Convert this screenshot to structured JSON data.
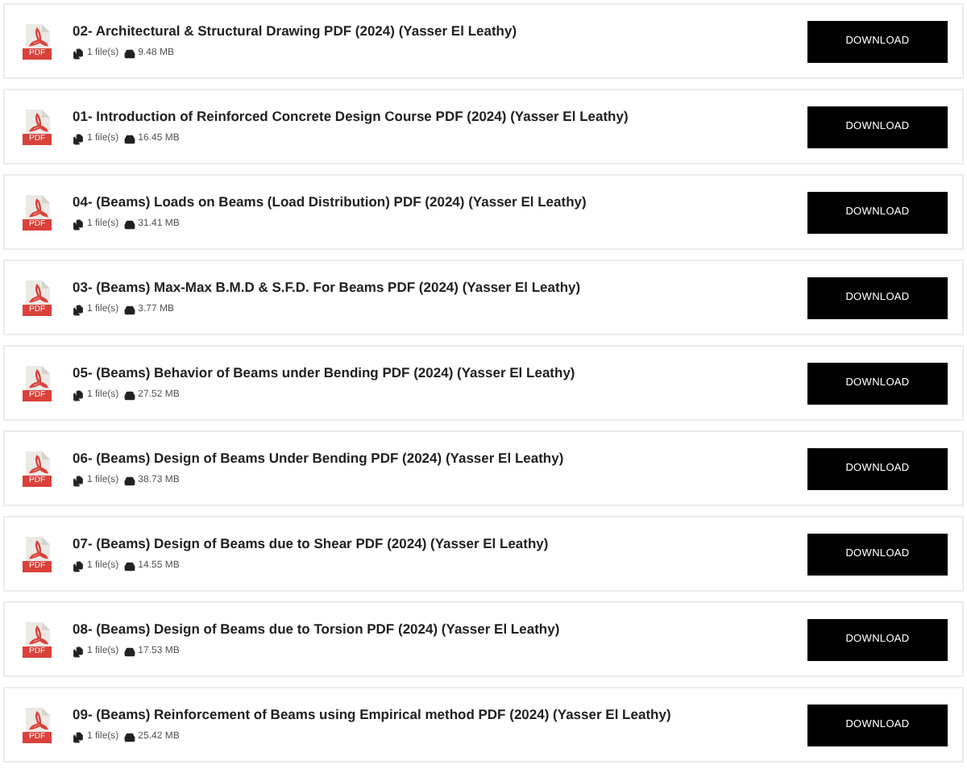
{
  "files": [
    {
      "icon_label": "PDF",
      "title": "02- Architectural & Structural Drawing PDF (2024) (Yasser El Leathy)",
      "file_count": "1 file(s)",
      "size": "9.48 MB",
      "button": "DOWNLOAD"
    },
    {
      "icon_label": "PDF",
      "title": "01- Introduction of Reinforced Concrete Design Course PDF (2024) (Yasser El Leathy)",
      "file_count": "1 file(s)",
      "size": "16.45 MB",
      "button": "DOWNLOAD"
    },
    {
      "icon_label": "PDF",
      "title": "04- (Beams) Loads on Beams (Load Distribution) PDF (2024) (Yasser El Leathy)",
      "file_count": "1 file(s)",
      "size": "31.41 MB",
      "button": "DOWNLOAD"
    },
    {
      "icon_label": "PDF",
      "title": "03- (Beams) Max-Max B.M.D & S.F.D. For Beams PDF (2024) (Yasser El Leathy)",
      "file_count": "1 file(s)",
      "size": "3.77 MB",
      "button": "DOWNLOAD"
    },
    {
      "icon_label": "PDF",
      "title": "05- (Beams) Behavior of Beams under Bending PDF (2024) (Yasser El Leathy)",
      "file_count": "1 file(s)",
      "size": "27.52 MB",
      "button": "DOWNLOAD"
    },
    {
      "icon_label": "PDF",
      "title": "06- (Beams) Design of Beams Under Bending PDF (2024) (Yasser El Leathy)",
      "file_count": "1 file(s)",
      "size": "38.73 MB",
      "button": "DOWNLOAD"
    },
    {
      "icon_label": "PDF",
      "title": "07- (Beams) Design of Beams due to Shear PDF (2024) (Yasser El Leathy)",
      "file_count": "1 file(s)",
      "size": "14.55 MB",
      "button": "DOWNLOAD"
    },
    {
      "icon_label": "PDF",
      "title": "08- (Beams) Design of Beams due to Torsion PDF (2024) (Yasser El Leathy)",
      "file_count": "1 file(s)",
      "size": "17.53 MB",
      "button": "DOWNLOAD"
    },
    {
      "icon_label": "PDF",
      "title": "09- (Beams) Reinforcement of Beams using Empirical method PDF (2024) (Yasser El Leathy)",
      "file_count": "1 file(s)",
      "size": "25.42 MB",
      "button": "DOWNLOAD"
    }
  ]
}
